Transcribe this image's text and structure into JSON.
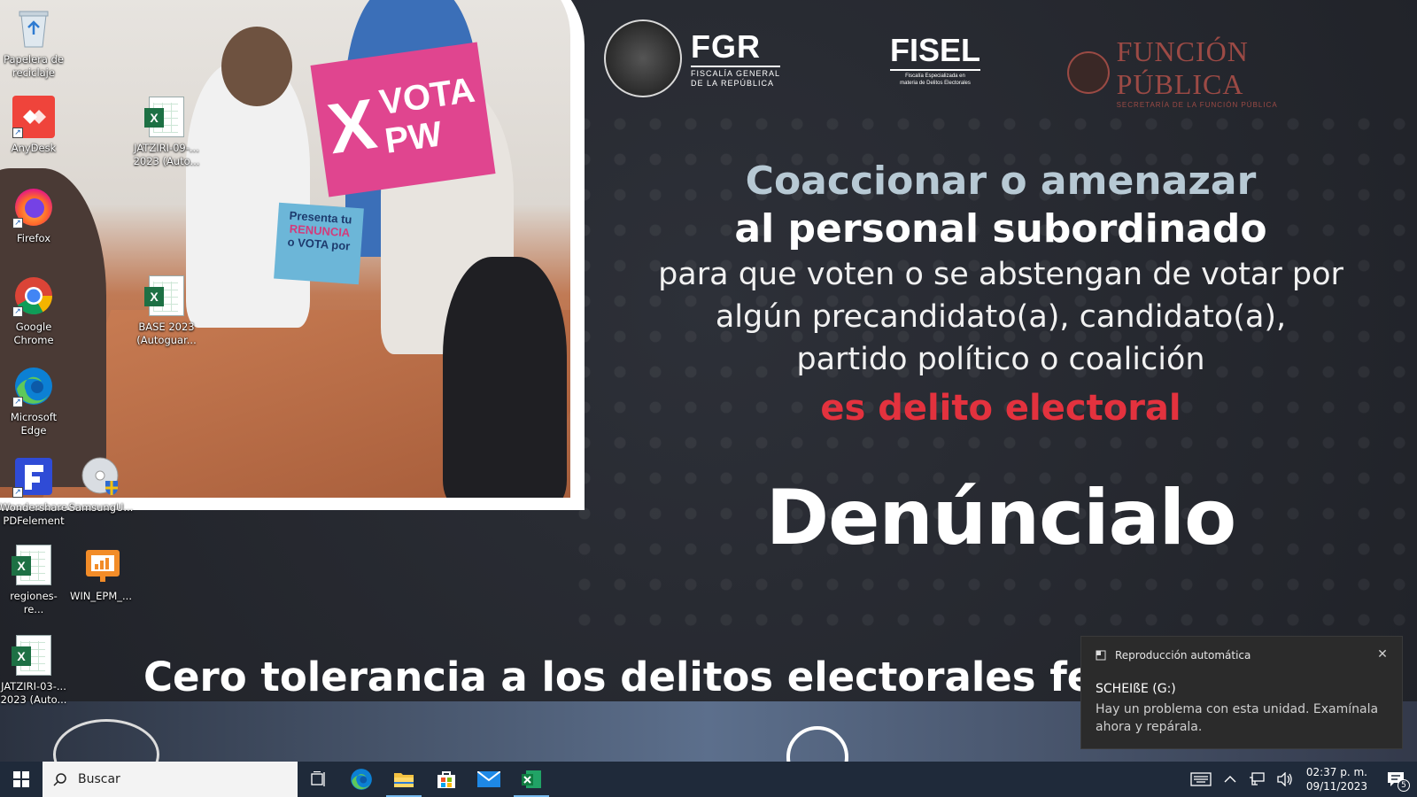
{
  "wallpaper": {
    "sign_pink": {
      "mark": "X",
      "line1": "VOTA",
      "line2": "PW"
    },
    "sign_blue": {
      "line1": "Presenta tu",
      "line2": "RENUNCIA",
      "line3": "o VOTA por"
    },
    "logos": {
      "fgr_title": "FGR",
      "fgr_sub1": "FISCALÍA GENERAL",
      "fgr_sub2": "DE LA REPÚBLICA",
      "fisel_title": "FISEL",
      "fisel_sub1": "Fiscalía Especializada en",
      "fisel_sub2": "materia de Delitos Electorales",
      "fp_title": "FUNCIÓN PÚBLICA",
      "fp_sub": "SECRETARÍA DE LA FUNCIÓN PÚBLICA"
    },
    "message": {
      "line1": "Coaccionar o amenazar",
      "line2": "al personal subordinado",
      "line3": "para que voten o se abstengan de votar por",
      "line4": "algún precandidato(a), candidato(a),",
      "line5": "partido político o coalición",
      "line6": "es delito electoral"
    },
    "cta": "Denúncialo",
    "slogan": "Cero tolerancia a los delitos electorales fed"
  },
  "desktop": {
    "icons": [
      {
        "label": "Papelera de reciclaje"
      },
      {
        "label": "AnyDesk"
      },
      {
        "label": "JATZIRI-09-... 2023 (Auto..."
      },
      {
        "label": "Firefox"
      },
      {
        "label": "Google Chrome"
      },
      {
        "label": "BASE 2023 (Autoguar..."
      },
      {
        "label": "Microsoft Edge"
      },
      {
        "label": "Wondershare PDFelement"
      },
      {
        "label": "SamsungU..."
      },
      {
        "label": "regiones-re..."
      },
      {
        "label": "WIN_EPM_..."
      },
      {
        "label": "JATZIRI-03-... 2023 (Auto..."
      }
    ]
  },
  "taskbar": {
    "search_placeholder": "Buscar",
    "clock_time": "02:37 p. m.",
    "clock_date": "09/11/2023",
    "notification_count": "5"
  },
  "toast": {
    "app": "Reproducción automática",
    "title": "SCHEIßE (G:)",
    "body": "Hay un problema con esta unidad. Examínala ahora y repárala."
  },
  "colors": {
    "alert_red": "#e3323e",
    "highlight_blue": "#b7c9d4",
    "taskbar_bg": "#1f2a3a",
    "fp_brand": "#9c4a45"
  }
}
